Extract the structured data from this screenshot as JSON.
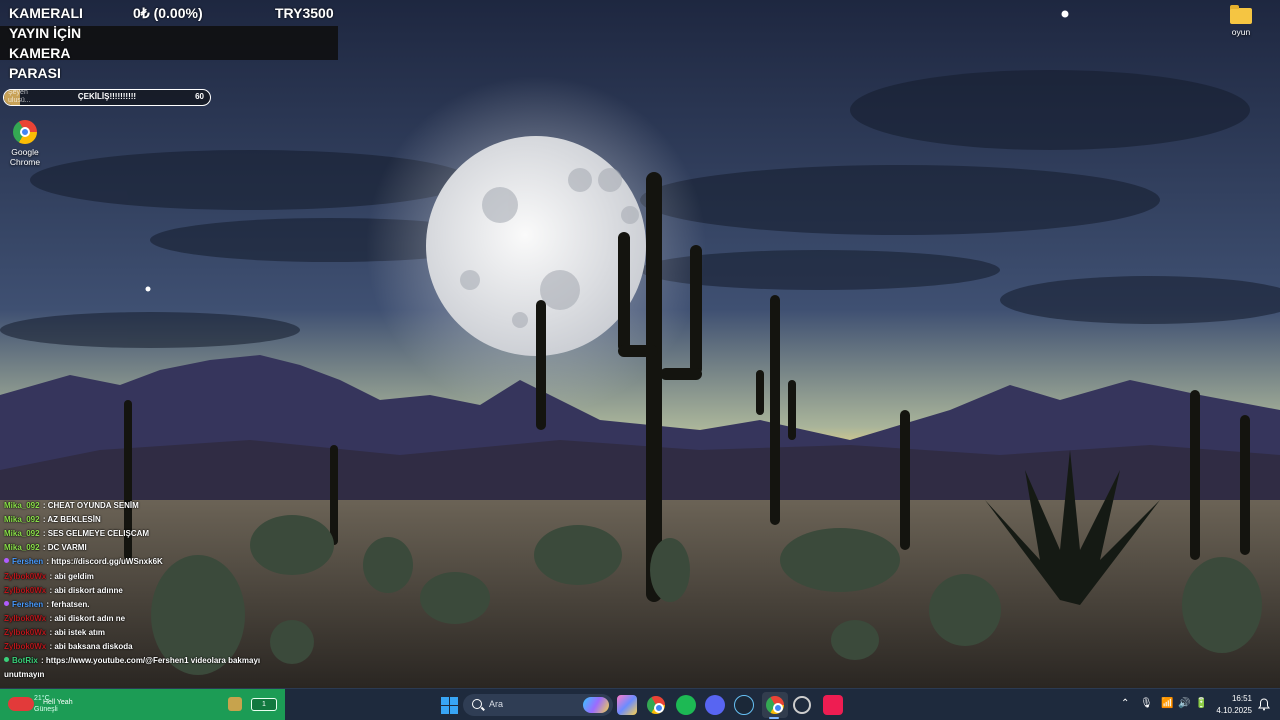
{
  "stream_overlay": {
    "goal_line1": "KAMERALI",
    "goal_line2": "YAYIN İÇİN",
    "goal_line3": "KAMERA",
    "goal_line4": "PARASI",
    "goal_current": "0₺ (0.00%)",
    "goal_target": "TRY3500",
    "goal_progress_percent": 0,
    "ghost_label_line1": "Şeyen",
    "ghost_label_line2": "ulusü...",
    "giveaway_title": "ÇEKİLİŞ!!!!!!!!!!",
    "giveaway_count": "60",
    "giveaway_progress_fraction": 0.08
  },
  "desktop": {
    "chrome_label_line1": "Google",
    "chrome_label_line2": "Chrome",
    "folder_label": "oyun"
  },
  "chat": [
    {
      "user": "Mika_092",
      "text": "CHEAT OYUNDA SENİM",
      "color": "#8be04a",
      "badge": ""
    },
    {
      "user": "Mika_092",
      "text": "AZ BEKLESİN",
      "color": "#8be04a",
      "badge": ""
    },
    {
      "user": "Mika_092",
      "text": "SES GELMEYE CELIŞCAM",
      "color": "#8be04a",
      "badge": ""
    },
    {
      "user": "Mika_092",
      "text": "DC VARMI",
      "color": "#8be04a",
      "badge": ""
    },
    {
      "user": "Fershen",
      "text": "https://discord.gg/uWSnxk6K",
      "color": "#4a9cff",
      "badge": "#b05cff"
    },
    {
      "user": "Zylbok0Wx",
      "text": "abi geldim",
      "color": "#b8171c",
      "badge": ""
    },
    {
      "user": "Zylbok0Wx",
      "text": "abi diskort adınne",
      "color": "#b8171c",
      "badge": ""
    },
    {
      "user": "Fershen",
      "text": "ferhatsen.",
      "color": "#4a9cff",
      "badge": "#b05cff"
    },
    {
      "user": "Zylbok0Wx",
      "text": "abi diskort adın ne",
      "color": "#b8171c",
      "badge": ""
    },
    {
      "user": "Zylbok0Wx",
      "text": "abi istek atım",
      "color": "#b8171c",
      "badge": ""
    },
    {
      "user": "Zylbok0Wx",
      "text": "abi baksana diskoda",
      "color": "#b8171c",
      "badge": ""
    },
    {
      "user": "BotRix",
      "text": "https://www.youtube.com/@Fershen1 videolara bakmayı",
      "color": "#3ad17a",
      "badge": "#3ad17a"
    },
    {
      "user": "",
      "text": "unutmayın",
      "color": "#ffffff",
      "badge": ""
    }
  ],
  "taskbar": {
    "weather_temp": "21°C",
    "weather_condition": "Güneşli",
    "now_playing": "Hell Yeah",
    "widget_pill": "1",
    "search_placeholder": "Ara",
    "clock_time": "16:51",
    "clock_date": "4.10.2025",
    "tray_up_arrow": "⌃",
    "tray_mic": "🎙",
    "tray_wifi": "📶",
    "tray_volume": "🔊",
    "tray_battery": "🔋"
  },
  "colors": {
    "taskbar_bg": "#1e2a3d",
    "weather_widget_bg": "#1c9c55",
    "goal_panel_bg": "#0f0f0f",
    "giveaway_fill": "#c8a257"
  }
}
